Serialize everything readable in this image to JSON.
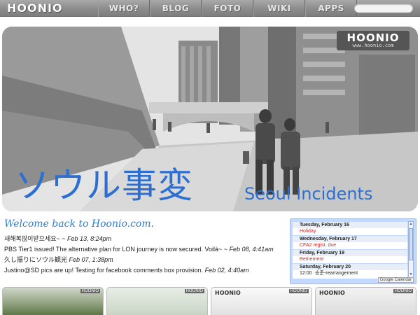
{
  "header": {
    "logo": "HOONIO",
    "nav": [
      "WHO?",
      "BLOG",
      "FOTO",
      "WIKI",
      "APPS"
    ],
    "search_placeholder": ""
  },
  "banner": {
    "logo": "HOONIO",
    "logo_url": "www.hoonio.com",
    "title_jp": "ソウル事変",
    "title_en": "Seoul Incidents"
  },
  "main": {
    "welcome": "Welcome back to Hoonio.com.",
    "posts": [
      {
        "title": "새해복많이받으세요~",
        "date": "Feb 13, 8:24pm"
      },
      {
        "title": "PBS Tier1 issued! The alternative plan for LON journey is now secured. Voilà~",
        "date": "Feb 08, 4:41am"
      },
      {
        "title": "久し振りにソウル観光",
        "date": "Feb 07, 1:38pm"
      },
      {
        "title": "Justino@SD pics are up! Testing for facebook comments box provision.",
        "date": "Feb 02, 4:40am"
      }
    ]
  },
  "calendar": {
    "days": [
      {
        "day": "Tuesday, February 16",
        "events": [
          {
            "time": "",
            "title": "Holiday",
            "color": "#dd2222"
          }
        ]
      },
      {
        "day": "Wednesday, February 17",
        "events": [
          {
            "time": "",
            "title": "CFA2 regist. due",
            "color": "#dd2222"
          }
        ]
      },
      {
        "day": "Friday, February 19",
        "events": [
          {
            "time": "",
            "title": "Retirement",
            "color": "#dd2222"
          }
        ]
      },
      {
        "day": "Saturday, February 20",
        "events": [
          {
            "time": "12:00",
            "title": "승준-rearrangement",
            "color": "#222222"
          }
        ]
      }
    ],
    "badge": "Google Calendar"
  },
  "thumbs": {
    "brand": "HOONIO",
    "tag": "HOONIO"
  }
}
